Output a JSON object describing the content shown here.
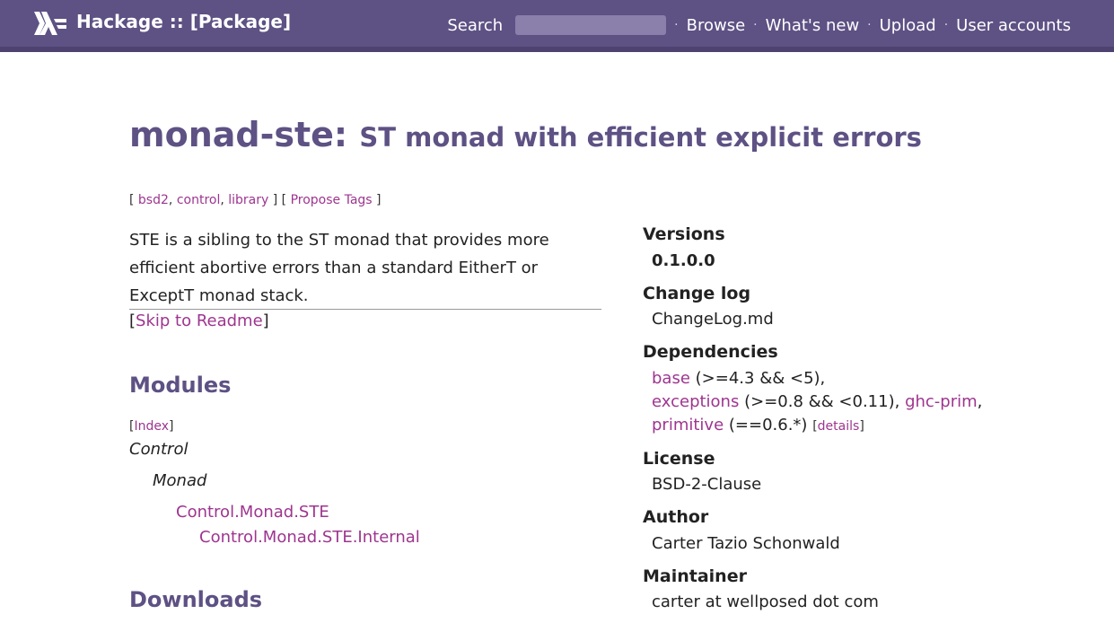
{
  "header": {
    "site_title": "Hackage :: [Package]",
    "search_label": "Search",
    "search_value": "",
    "nav": [
      "Browse",
      "What's new",
      "Upload",
      "User accounts"
    ],
    "separator": "·",
    "colors": {
      "bar": "#5e5184",
      "bar_border": "#4e4370"
    }
  },
  "package": {
    "name": "monad-ste:",
    "synopsis": "ST monad with efficient explicit errors",
    "tags": [
      "bsd2",
      "control",
      "library"
    ],
    "propose_tags": "Propose Tags",
    "description": "STE is a sibling to the ST monad that provides more efficient abortive errors than a standard EitherT or ExceptT monad stack.",
    "skip_readme": "Skip to Readme"
  },
  "modules": {
    "heading": "Modules",
    "index_link": "Index",
    "tree": {
      "control": "Control",
      "monad": "Monad",
      "ste": "Control.Monad.STE",
      "ste_internal": "Control.Monad.STE.Internal"
    }
  },
  "downloads": {
    "heading": "Downloads"
  },
  "properties": {
    "versions_label": "Versions",
    "versions_value": "0.1.0.0",
    "changelog_label": "Change log",
    "changelog_value": "ChangeLog.md",
    "dependencies_label": "Dependencies",
    "deps": {
      "base": "base",
      "base_range": "(>=4.3 && <5),",
      "exceptions": "exceptions",
      "exceptions_range": "(>=0.8 && <0.11),",
      "ghc_prim": "ghc-prim",
      "comma": ",",
      "primitive": "primitive",
      "primitive_range": "(==0.6.*)",
      "details": "details"
    },
    "license_label": "License",
    "license_value": "BSD-2-Clause",
    "author_label": "Author",
    "author_value": "Carter Tazio Schonwald",
    "maintainer_label": "Maintainer",
    "maintainer_value": "carter at wellposed dot com"
  },
  "colors": {
    "link": "#9e358f",
    "heading": "#5e5184"
  },
  "icons": {
    "logo": "haskell-logo-icon"
  }
}
